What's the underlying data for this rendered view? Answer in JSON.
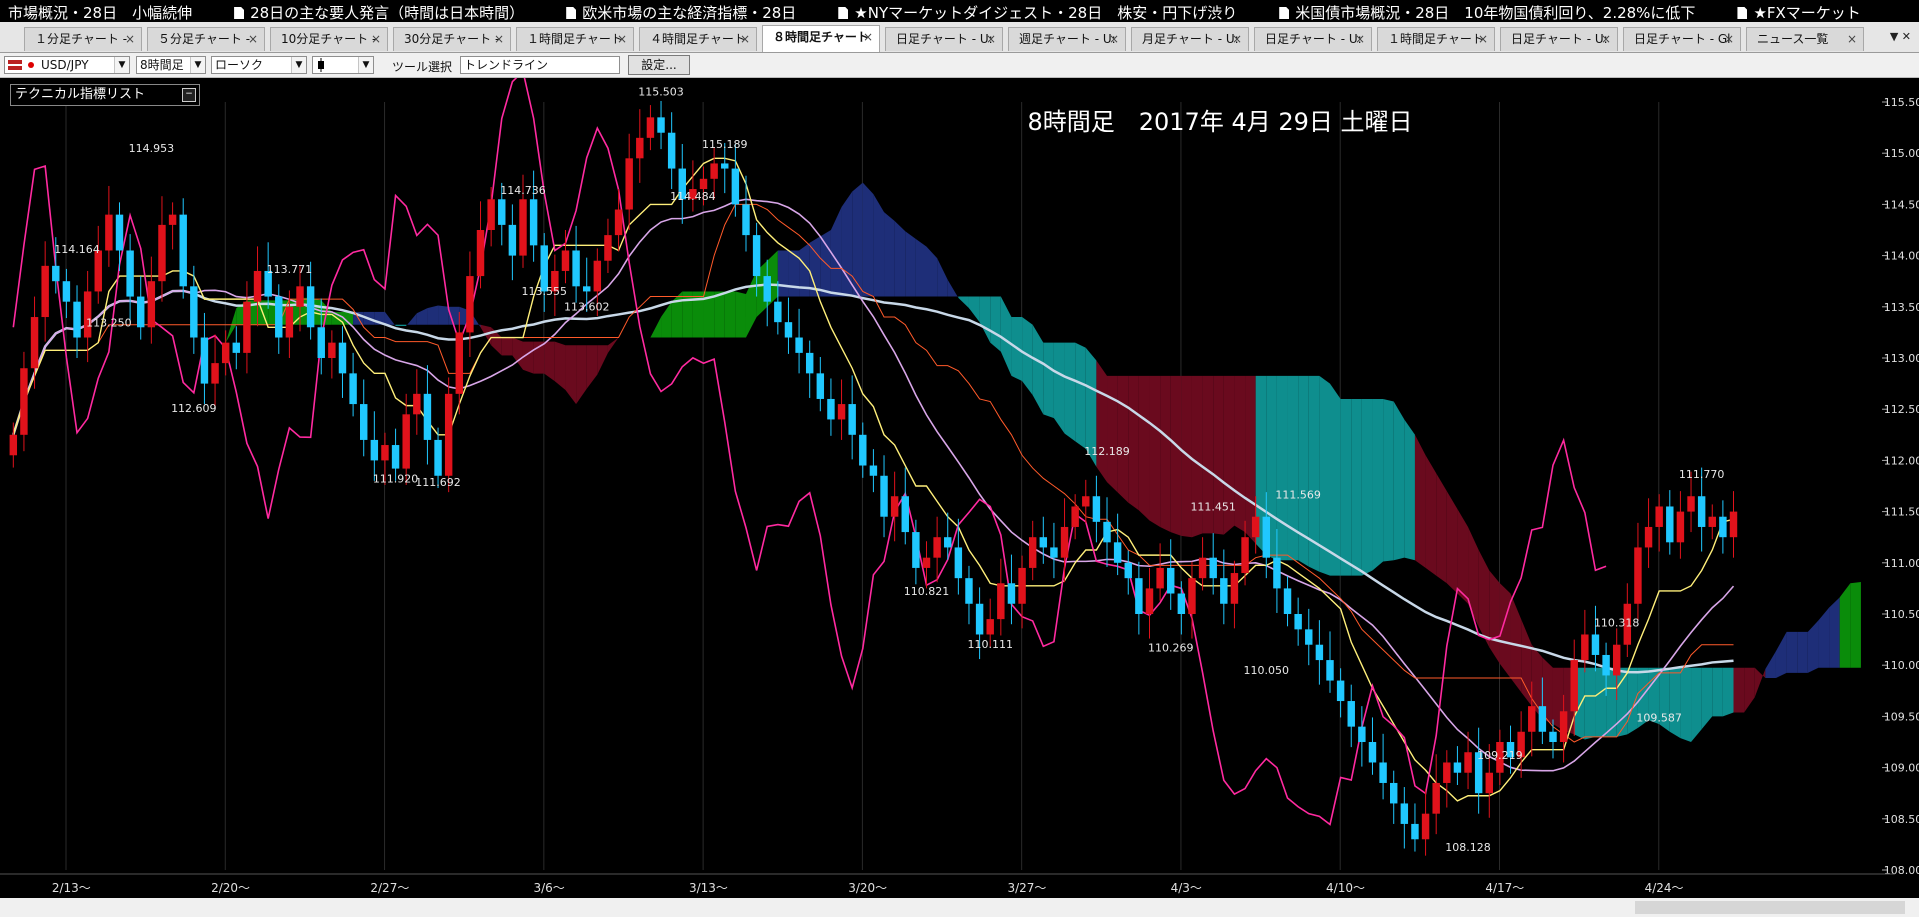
{
  "ticker": [
    "市場概況・28日　小幅続伸",
    "28日の主な要人発言（時間は日本時間）",
    "欧米市場の主な経済指標・28日",
    "★NYマーケットダイジェスト・28日　株安・円下げ渋り",
    "米国債市場概況・28日　10年物国債利回り、2.28%に低下",
    "★FXマーケット"
  ],
  "tabs": [
    "１分足チャート -",
    "５分足チャート -",
    "10分足チャート -",
    "30分足チャート -",
    "１時間足チャート",
    "４時間足チャート",
    "８時間足チャート",
    "日足チャート - U:",
    "週足チャート - U:",
    "月足チャート - U:",
    "日足チャート - U:",
    "１時間足チャート",
    "日足チャート - U:",
    "日足チャート - Gl",
    "ニュース一覧"
  ],
  "active_tab_index": 6,
  "toolbar": {
    "symbol": "USD/JPY",
    "timeframe": "8時間足",
    "chart_style": "ローソク",
    "candle_icon": "candlestick-icon",
    "tool_label": "ツール選択",
    "tool_value": "トレンドライン",
    "settings_button": "設定..."
  },
  "indicator_list_label": "テクニカル指標リスト",
  "chart_data": {
    "type": "candlestick",
    "title": "8時間足　2017年 4月 29日 土曜日",
    "symbol": "USD/JPY",
    "ylim": [
      108.0,
      115.5
    ],
    "y_ticks": [
      "115.50",
      "115.00",
      "114.50",
      "114.00",
      "113.50",
      "113.00",
      "112.50",
      "112.00",
      "111.50",
      "111.00",
      "110.50",
      "110.00",
      "109.50",
      "109.00",
      "108.50",
      "108.00"
    ],
    "x_ticks": [
      "2/13～",
      "2/20～",
      "2/27～",
      "3/6～",
      "3/13～",
      "3/20～",
      "3/27～",
      "4/3～",
      "4/10～",
      "4/17～",
      "4/24～"
    ],
    "price_labels": [
      {
        "text": "114.953",
        "value": 114.953,
        "bar": 13
      },
      {
        "text": "114.164",
        "value": 114.164,
        "bar": 6
      },
      {
        "text": "113.250",
        "value": 113.25,
        "bar": 9
      },
      {
        "text": "112.609",
        "value": 112.609,
        "bar": 17
      },
      {
        "text": "113.771",
        "value": 113.771,
        "bar": 26
      },
      {
        "text": "111.920",
        "value": 111.92,
        "bar": 36
      },
      {
        "text": "111.692",
        "value": 111.692,
        "bar": 40
      },
      {
        "text": "114.736",
        "value": 114.736,
        "bar": 48
      },
      {
        "text": "113.555",
        "value": 113.555,
        "bar": 50
      },
      {
        "text": "113.602",
        "value": 113.602,
        "bar": 54
      },
      {
        "text": "115.503",
        "value": 115.503,
        "bar": 61
      },
      {
        "text": "115.189",
        "value": 115.189,
        "bar": 67
      },
      {
        "text": "114.484",
        "value": 114.484,
        "bar": 64
      },
      {
        "text": "110.821",
        "value": 110.821,
        "bar": 86
      },
      {
        "text": "110.111",
        "value": 110.111,
        "bar": 92
      },
      {
        "text": "112.189",
        "value": 112.189,
        "bar": 103
      },
      {
        "text": "111.451",
        "value": 111.451,
        "bar": 113
      },
      {
        "text": "110.269",
        "value": 110.269,
        "bar": 109
      },
      {
        "text": "111.569",
        "value": 111.569,
        "bar": 121
      },
      {
        "text": "110.050",
        "value": 110.05,
        "bar": 118
      },
      {
        "text": "108.128",
        "value": 108.128,
        "bar": 137
      },
      {
        "text": "109.219",
        "value": 109.219,
        "bar": 140
      },
      {
        "text": "110.318",
        "value": 110.318,
        "bar": 151
      },
      {
        "text": "109.587",
        "value": 109.587,
        "bar": 155
      },
      {
        "text": "111.770",
        "value": 111.77,
        "bar": 159
      }
    ],
    "series_colors": {
      "up_candle": "#e0121b",
      "down_candle": "#20c8ff",
      "conversion_line": "#ffef7a",
      "base_line": "#ff5a2a",
      "moving_avg_short": "#d8a6e8",
      "moving_avg_long": "#c8d8e8",
      "lagging_span": "#ff2aa0",
      "cloud_bullish": "#0a8c0a",
      "cloud_bearish": "#6a0a1e",
      "cloud_teal": "#0e8e8e",
      "cloud_navy": "#1e2e78"
    },
    "closes": [
      112.25,
      112.9,
      113.4,
      113.9,
      113.75,
      113.55,
      113.2,
      113.65,
      114.05,
      114.4,
      114.05,
      113.6,
      113.3,
      113.75,
      114.3,
      114.4,
      113.7,
      113.2,
      112.75,
      112.95,
      113.15,
      113.05,
      113.55,
      113.85,
      113.6,
      113.2,
      113.5,
      113.7,
      113.3,
      113.0,
      113.15,
      112.85,
      112.55,
      112.2,
      112.0,
      112.15,
      111.92,
      112.45,
      112.65,
      112.2,
      111.85,
      112.65,
      113.25,
      113.8,
      114.25,
      114.55,
      114.3,
      114.0,
      114.55,
      114.1,
      113.65,
      113.85,
      114.05,
      113.7,
      113.65,
      113.95,
      114.2,
      114.45,
      114.95,
      115.15,
      115.35,
      115.2,
      114.85,
      114.55,
      114.65,
      114.75,
      114.9,
      114.85,
      114.5,
      114.2,
      113.8,
      113.55,
      113.35,
      113.2,
      113.05,
      112.85,
      112.6,
      112.4,
      112.55,
      112.25,
      111.95,
      111.85,
      111.45,
      111.65,
      111.3,
      110.95,
      111.05,
      111.25,
      111.15,
      110.85,
      110.6,
      110.3,
      110.45,
      110.8,
      110.6,
      110.95,
      111.25,
      111.15,
      111.05,
      111.35,
      111.55,
      111.65,
      111.4,
      111.2,
      111.0,
      110.85,
      110.5,
      110.75,
      110.95,
      110.7,
      110.5,
      110.85,
      111.05,
      110.85,
      110.6,
      110.9,
      111.25,
      111.45,
      111.05,
      110.75,
      110.5,
      110.35,
      110.2,
      110.05,
      109.85,
      109.65,
      109.4,
      109.25,
      109.05,
      108.85,
      108.65,
      108.45,
      108.3,
      108.55,
      108.85,
      109.05,
      108.95,
      109.15,
      108.75,
      108.95,
      109.25,
      109.1,
      109.35,
      109.6,
      109.35,
      109.25,
      109.55,
      110.05,
      110.3,
      110.1,
      109.9,
      110.2,
      110.6,
      111.15,
      111.35,
      111.55,
      111.2,
      111.5,
      111.65,
      111.35,
      111.45,
      111.25,
      111.5
    ]
  }
}
